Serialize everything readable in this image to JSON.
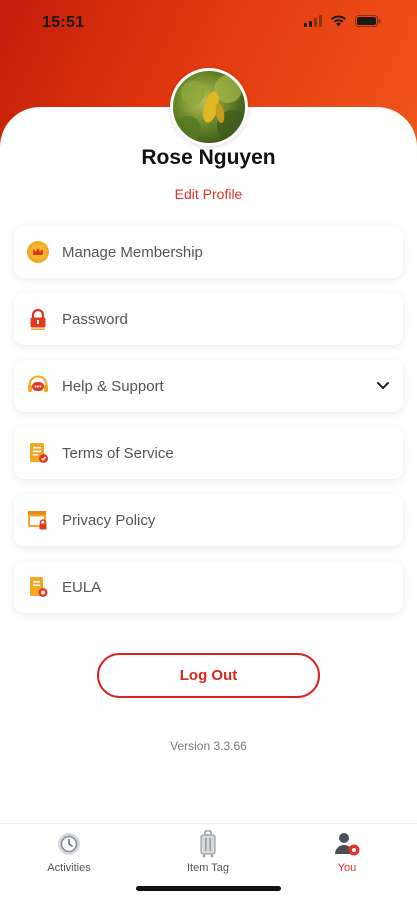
{
  "status_bar": {
    "time": "15:51"
  },
  "profile": {
    "name": "Rose Nguyen",
    "edit_label": "Edit Profile"
  },
  "menu": [
    {
      "label": "Manage Membership",
      "icon": "crown-icon"
    },
    {
      "label": "Password",
      "icon": "lock-icon"
    },
    {
      "label": "Help & Support",
      "icon": "headset-icon",
      "expandable": true
    },
    {
      "label": "Terms of Service",
      "icon": "document-icon"
    },
    {
      "label": "Privacy Policy",
      "icon": "privacy-window-icon"
    },
    {
      "label": "EULA",
      "icon": "license-document-icon"
    }
  ],
  "logout_label": "Log Out",
  "version": "Version 3.3.66",
  "tabs": [
    {
      "label": "Activities",
      "icon": "clock-icon"
    },
    {
      "label": "Item Tag",
      "icon": "luggage-icon"
    },
    {
      "label": "You",
      "icon": "user-settings-icon",
      "active": true
    }
  ],
  "colors": {
    "accent": "#e0312a",
    "header_gradient_start": "#c41d0a",
    "header_gradient_end": "#f0561a",
    "icon_gold": "#f5a623"
  }
}
